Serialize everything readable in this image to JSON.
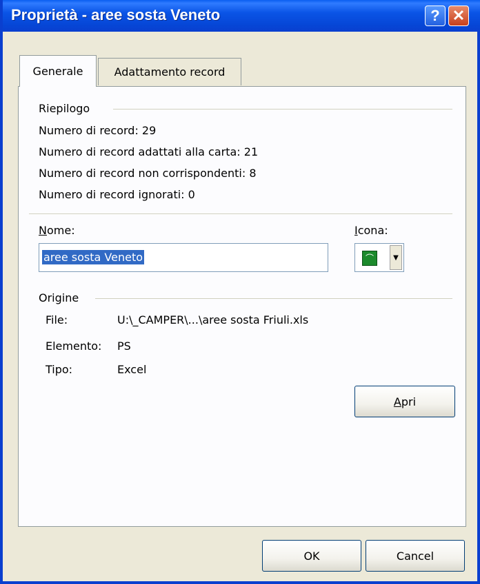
{
  "window": {
    "title": "Proprietà - aree sosta Veneto",
    "help_glyph": "?",
    "close_glyph": "✕"
  },
  "tabs": [
    {
      "label": "Generale",
      "active": true
    },
    {
      "label": "Adattamento record",
      "active": false
    }
  ],
  "summary": {
    "title": "Riepilogo",
    "lines": [
      "Numero di record: 29",
      "Numero di record adattati alla carta: 21",
      "Numero di record non corrispondenti: 8",
      "Numero di record ignorati: 0"
    ]
  },
  "name": {
    "label_accel": "N",
    "label_rest": "ome:",
    "value": "aree sosta Veneto"
  },
  "icon": {
    "label_accel": "I",
    "label_rest": "cona:",
    "selected_icon": "camper-green-icon",
    "color": "#1c8a2c"
  },
  "origin": {
    "title": "Origine",
    "file_label": "File:",
    "file_value": "U:\\_CAMPER\\...\\aree sosta Friuli.xls",
    "element_label": "Elemento:",
    "element_value": "PS",
    "type_label": "Tipo:",
    "type_value": "Excel"
  },
  "buttons": {
    "apri_accel": "A",
    "apri_rest": "pri",
    "ok": "OK",
    "cancel": "Cancel"
  }
}
